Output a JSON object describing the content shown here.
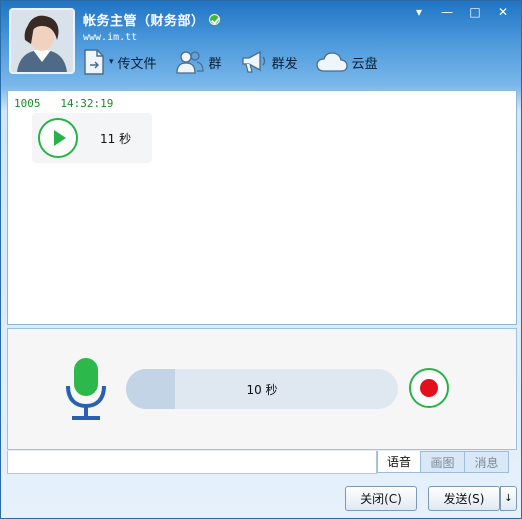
{
  "window": {
    "title": "帐务主管（财务部）",
    "subtitle": "www.im.tt",
    "controls": {
      "menu": "▾",
      "minimize": "—",
      "maximize": "□",
      "close": "✕"
    }
  },
  "toolbar": {
    "transfer_file": "传文件",
    "dropdown_arrow": "▾",
    "group": "群",
    "broadcast": "群发",
    "cloud_disk": "云盘"
  },
  "messages": [
    {
      "sender": "1005",
      "time": "14:32:19",
      "voice_duration": "11 秒"
    }
  ],
  "recorder": {
    "elapsed": "10 秒",
    "progress": 0.18
  },
  "tabs": [
    {
      "label": "语音",
      "active": true
    },
    {
      "label": "画图",
      "active": false
    },
    {
      "label": "消息",
      "active": false
    }
  ],
  "buttons": {
    "close": "关闭(C)",
    "send": "发送(S)",
    "send_options": "↓"
  },
  "colors": {
    "accent_green": "#28b34a",
    "record_red": "#e20f1c",
    "mic_green": "#2db84b",
    "mic_blue": "#2b5fb0"
  }
}
